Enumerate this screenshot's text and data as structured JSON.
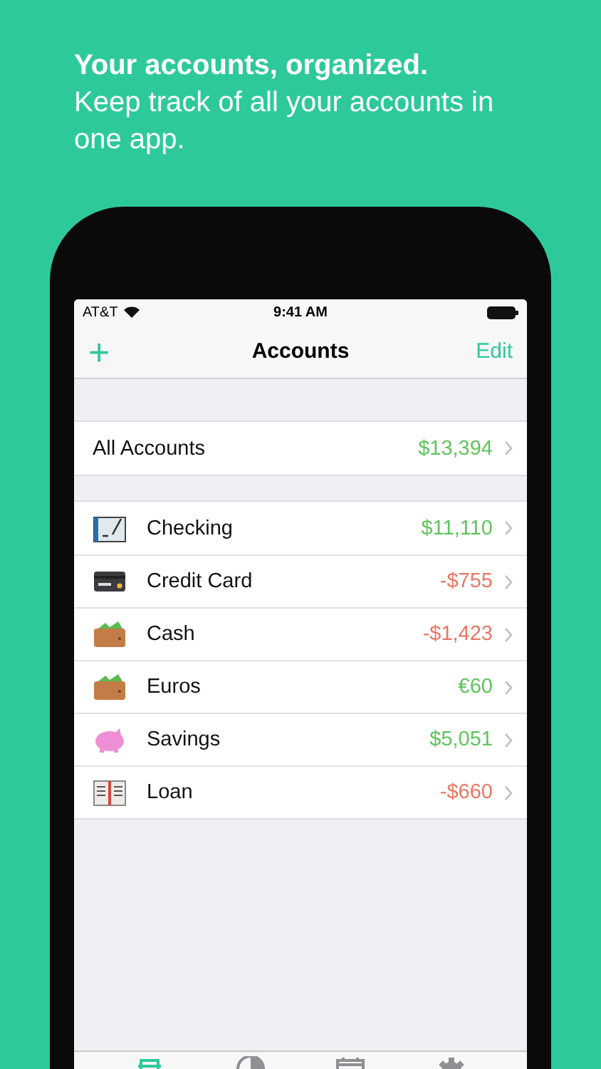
{
  "headline": {
    "title": "Your accounts, organized.",
    "subtitle": "Keep track of all your accounts in one app."
  },
  "status_bar": {
    "carrier": "AT&T",
    "time": "9:41 AM"
  },
  "nav_bar": {
    "add": "+",
    "title": "Accounts",
    "edit": "Edit"
  },
  "summary": {
    "name": "All Accounts",
    "amount": "$13,394",
    "color": "#5ec45c"
  },
  "accounts": [
    {
      "kind": "checkbook",
      "name": "Checking",
      "amount": "$11,110",
      "color": "#5ec45c"
    },
    {
      "kind": "card",
      "name": "Credit Card",
      "amount": "-$755",
      "color": "#ec7563"
    },
    {
      "kind": "wallet",
      "name": "Cash",
      "amount": "-$1,423",
      "color": "#ec7563"
    },
    {
      "kind": "wallet",
      "name": "Euros",
      "amount": "€60",
      "color": "#5ec45c"
    },
    {
      "kind": "piggy",
      "name": "Savings",
      "amount": "$5,051",
      "color": "#5ec45c"
    },
    {
      "kind": "ledger",
      "name": "Loan",
      "amount": "-$660",
      "color": "#ec7563"
    }
  ],
  "tab_bar": [
    {
      "kind": "accounts",
      "selected": true
    },
    {
      "kind": "reports",
      "selected": false
    },
    {
      "kind": "calendar",
      "selected": false
    },
    {
      "kind": "settings",
      "selected": false
    }
  ]
}
